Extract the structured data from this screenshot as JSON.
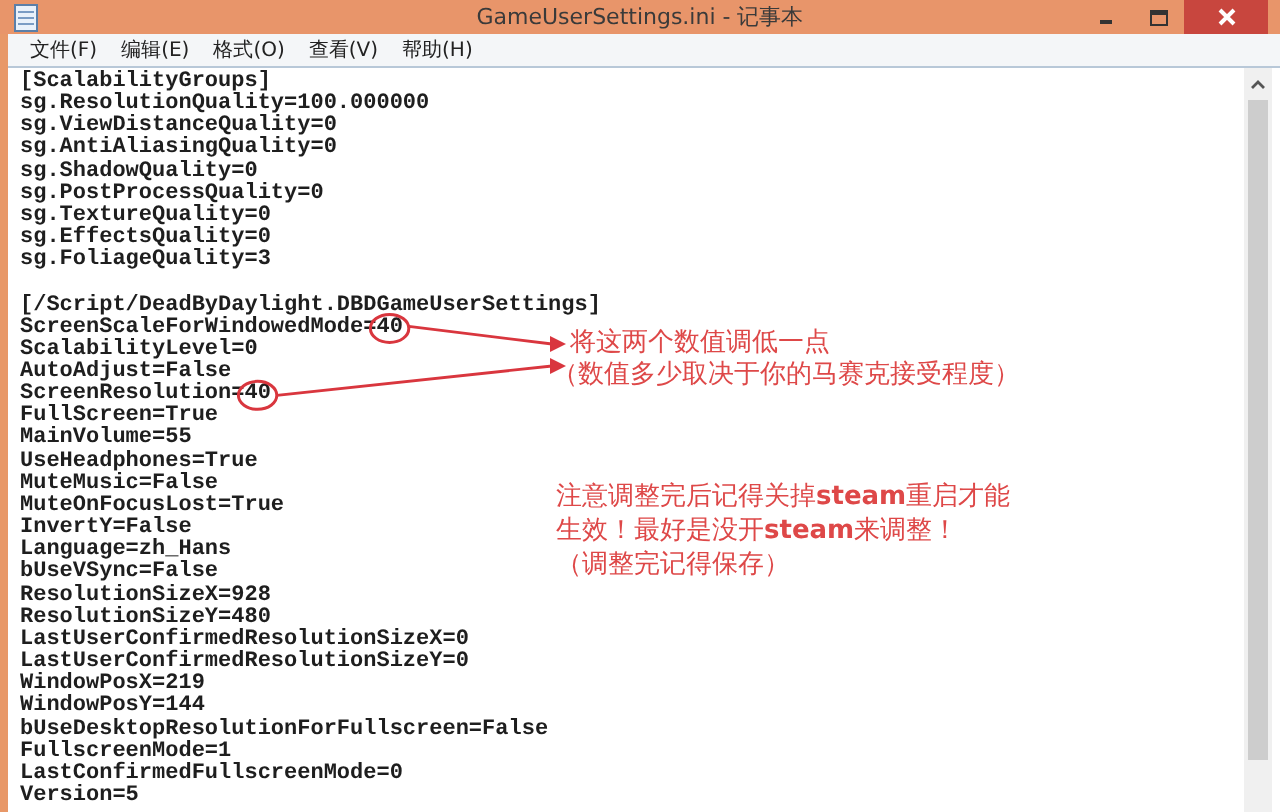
{
  "window": {
    "title": "GameUserSettings.ini - 记事本"
  },
  "menu": [
    "文件(F)",
    "编辑(E)",
    "格式(O)",
    "查看(V)",
    "帮助(H)"
  ],
  "sections": [
    {
      "header": "[ScalabilityGroups]",
      "lines": [
        {
          "text": "sg.ResolutionQuality=100.000000",
          "circled": false
        },
        {
          "text": "sg.ViewDistanceQuality=0",
          "circled": false
        },
        {
          "text": "sg.AntiAliasingQuality=0",
          "circled": false
        },
        {
          "text": "sg.ShadowQuality=0",
          "circled": false
        },
        {
          "text": "sg.PostProcessQuality=0",
          "circled": false
        },
        {
          "text": "sg.TextureQuality=0",
          "circled": false
        },
        {
          "text": "sg.EffectsQuality=0",
          "circled": false
        },
        {
          "text": "sg.FoliageQuality=3",
          "circled": false
        }
      ]
    },
    {
      "header": "[/Script/DeadByDaylight.DBDGameUserSettings]",
      "lines": [
        {
          "text": "ScreenScaleForWindowedMode=40",
          "circled": true
        },
        {
          "text": "ScalabilityLevel=0",
          "circled": false
        },
        {
          "text": "AutoAdjust=False",
          "circled": false
        },
        {
          "text": "ScreenResolution=40",
          "circled": true
        },
        {
          "text": "FullScreen=True",
          "circled": false
        },
        {
          "text": "MainVolume=55",
          "circled": false
        },
        {
          "text": "UseHeadphones=True",
          "circled": false
        },
        {
          "text": "MuteMusic=False",
          "circled": false
        },
        {
          "text": "MuteOnFocusLost=True",
          "circled": false
        },
        {
          "text": "InvertY=False",
          "circled": false
        },
        {
          "text": "Language=zh_Hans",
          "circled": false
        },
        {
          "text": "bUseVSync=False",
          "circled": false
        },
        {
          "text": "ResolutionSizeX=928",
          "circled": false
        },
        {
          "text": "ResolutionSizeY=480",
          "circled": false
        },
        {
          "text": "LastUserConfirmedResolutionSizeX=0",
          "circled": false
        },
        {
          "text": "LastUserConfirmedResolutionSizeY=0",
          "circled": false
        },
        {
          "text": "WindowPosX=219",
          "circled": false
        },
        {
          "text": "WindowPosY=144",
          "circled": false
        },
        {
          "text": "bUseDesktopResolutionForFullscreen=False",
          "circled": false
        },
        {
          "text": "FullscreenMode=1",
          "circled": false
        },
        {
          "text": "LastConfirmedFullscreenMode=0",
          "circled": false
        },
        {
          "text": "Version=5",
          "circled": false
        }
      ]
    }
  ],
  "annotations": {
    "callout": [
      "将这两个数值调低一点",
      "（数值多少取决于你的马赛克接受程度）"
    ],
    "note": [
      "注意调整完后记得关掉**steam**重启才能",
      "生效！最好是没开**steam**来调整！",
      "（调整完记得保存）"
    ]
  }
}
